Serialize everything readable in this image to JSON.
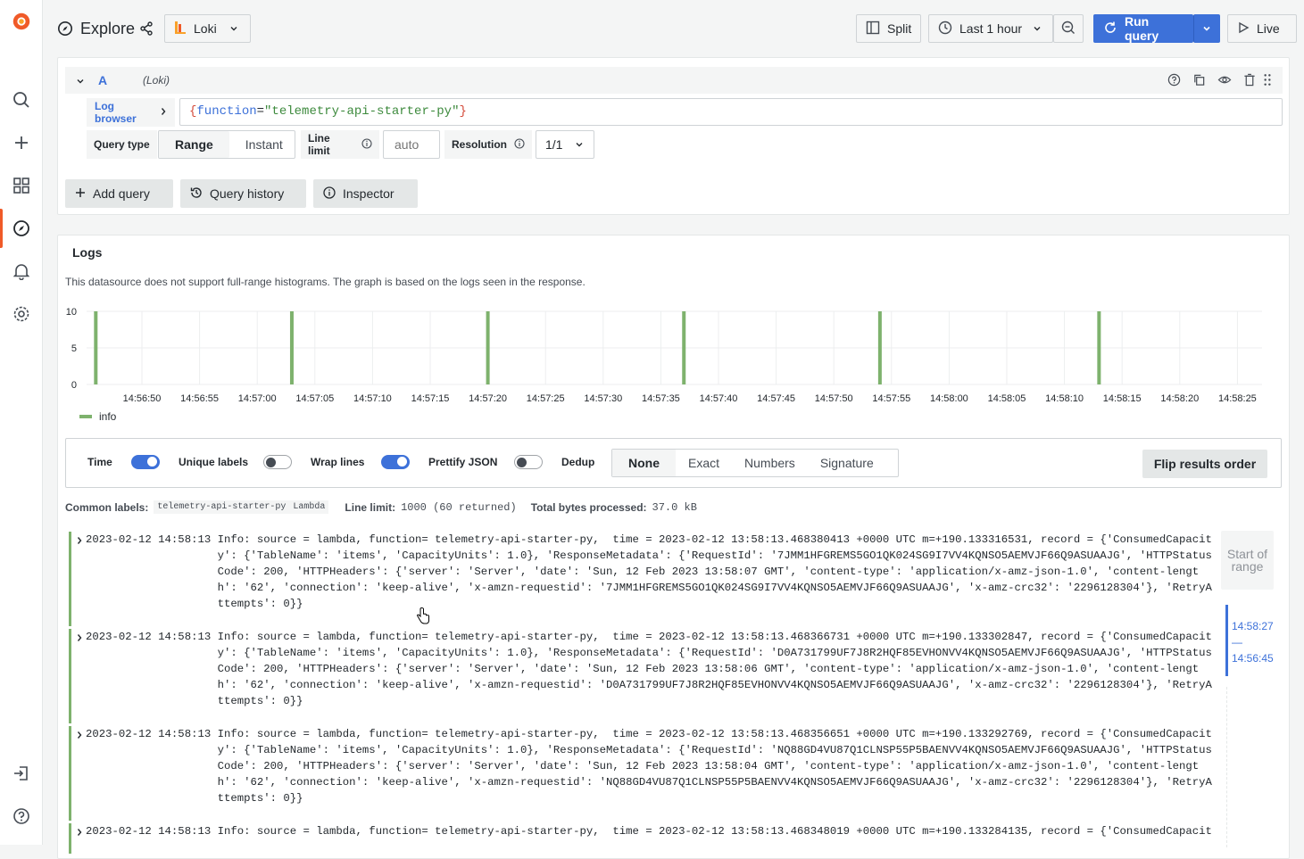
{
  "topbar": {
    "title": "Explore",
    "datasource": "Loki",
    "split": "Split",
    "time_range": "Last 1 hour",
    "run_query": "Run query",
    "live": "Live"
  },
  "query": {
    "ref_id": "A",
    "datasource_hint": "(Loki)",
    "log_browser": "Log browser",
    "expression_key": "function",
    "expression_value": "\"telemetry-api-starter-py\"",
    "query_type_label": "Query type",
    "query_type_options": [
      "Range",
      "Instant"
    ],
    "query_type_selected": "Range",
    "line_limit_label": "Line limit",
    "line_limit_placeholder": "auto",
    "resolution_label": "Resolution",
    "resolution_value": "1/1"
  },
  "actions": {
    "add_query": "Add query",
    "query_history": "Query history",
    "inspector": "Inspector"
  },
  "logs": {
    "title": "Logs",
    "notice": "This datasource does not support full-range histograms. The graph is based on the logs seen in the response.",
    "options": {
      "time": "Time",
      "unique_labels": "Unique labels",
      "wrap_lines": "Wrap lines",
      "prettify_json": "Prettify JSON",
      "dedup": "Dedup",
      "dedup_options": [
        "None",
        "Exact",
        "Numbers",
        "Signature"
      ],
      "dedup_selected": "None",
      "flip": "Flip results order"
    },
    "common_labels_label": "Common labels:",
    "common_labels": [
      "telemetry-api-starter-py",
      "Lambda"
    ],
    "line_limit_label": "Line limit:",
    "line_limit_value": "1000 (60 returned)",
    "bytes_label": "Total bytes processed:",
    "bytes_value": "37.0 kB",
    "range_start": "Start of range",
    "range_to": "14:58:27",
    "range_dash": "—",
    "range_from": "14:56:45",
    "entries": [
      {
        "lines": [
          "2023-02-12 14:58:13 Info: source = lambda, function= telemetry-api-starter-py,  time = 2023-02-12 13:58:13.468380413 +0000 UTC m=+190.133316531, record = {'ConsumedCapacit",
          "                    y': {'TableName': 'items', 'CapacityUnits': 1.0}, 'ResponseMetadata': {'RequestId': '7JMM1HFGREMS5GO1QK024SG9I7VV4KQNSO5AEMVJF66Q9ASUAAJG', 'HTTPStatus",
          "                    Code': 200, 'HTTPHeaders': {'server': 'Server', 'date': 'Sun, 12 Feb 2023 13:58:07 GMT', 'content-type': 'application/x-amz-json-1.0', 'content-lengt",
          "                    h': '62', 'connection': 'keep-alive', 'x-amzn-requestid': '7JMM1HFGREMS5GO1QK024SG9I7VV4KQNSO5AEMVJF66Q9ASUAAJG', 'x-amz-crc32': '2296128304'}, 'RetryA",
          "                    ttempts': 0}}"
        ]
      },
      {
        "lines": [
          "2023-02-12 14:58:13 Info: source = lambda, function= telemetry-api-starter-py,  time = 2023-02-12 13:58:13.468366731 +0000 UTC m=+190.133302847, record = {'ConsumedCapacit",
          "                    y': {'TableName': 'items', 'CapacityUnits': 1.0}, 'ResponseMetadata': {'RequestId': 'D0A731799UF7J8R2HQF85EVHONVV4KQNSO5AEMVJF66Q9ASUAAJG', 'HTTPStatus",
          "                    Code': 200, 'HTTPHeaders': {'server': 'Server', 'date': 'Sun, 12 Feb 2023 13:58:06 GMT', 'content-type': 'application/x-amz-json-1.0', 'content-lengt",
          "                    h': '62', 'connection': 'keep-alive', 'x-amzn-requestid': 'D0A731799UF7J8R2HQF85EVHONVV4KQNSO5AEMVJF66Q9ASUAAJG', 'x-amz-crc32': '2296128304'}, 'RetryA",
          "                    ttempts': 0}}"
        ]
      },
      {
        "lines": [
          "2023-02-12 14:58:13 Info: source = lambda, function= telemetry-api-starter-py,  time = 2023-02-12 13:58:13.468356651 +0000 UTC m=+190.133292769, record = {'ConsumedCapacit",
          "                    y': {'TableName': 'items', 'CapacityUnits': 1.0}, 'ResponseMetadata': {'RequestId': 'NQ88GD4VU87Q1CLNSP55P5BAENVV4KQNSO5AEMVJF66Q9ASUAAJG', 'HTTPStatus",
          "                    Code': 200, 'HTTPHeaders': {'server': 'Server', 'date': 'Sun, 12 Feb 2023 13:58:04 GMT', 'content-type': 'application/x-amz-json-1.0', 'content-lengt",
          "                    h': '62', 'connection': 'keep-alive', 'x-amzn-requestid': 'NQ88GD4VU87Q1CLNSP55P5BAENVV4KQNSO5AEMVJF66Q9ASUAAJG', 'x-amz-crc32': '2296128304'}, 'RetryA",
          "                    ttempts': 0}}"
        ]
      },
      {
        "lines": [
          "2023-02-12 14:58:13 Info: source = lambda, function= telemetry-api-starter-py,  time = 2023-02-12 13:58:13.468348019 +0000 UTC m=+190.133284135, record = {'ConsumedCapacit"
        ]
      }
    ]
  },
  "chart_data": {
    "type": "bar",
    "series": [
      {
        "name": "info",
        "color": "#7eb26d"
      }
    ],
    "ylim": [
      0,
      10
    ],
    "yticks": [
      "10",
      "5",
      "0"
    ],
    "xticks": [
      "14:56:50",
      "14:56:55",
      "14:57:00",
      "14:57:05",
      "14:57:10",
      "14:57:15",
      "14:57:20",
      "14:57:25",
      "14:57:30",
      "14:57:35",
      "14:57:40",
      "14:57:45",
      "14:57:50",
      "14:57:55",
      "14:58:00",
      "14:58:05",
      "14:58:10",
      "14:58:15",
      "14:58:20",
      "14:58:25"
    ],
    "bars": [
      {
        "x": "14:56:46",
        "value": 10
      },
      {
        "x": "14:57:03",
        "value": 10
      },
      {
        "x": "14:57:20",
        "value": 10
      },
      {
        "x": "14:57:37",
        "value": 10
      },
      {
        "x": "14:57:54",
        "value": 10
      },
      {
        "x": "14:58:13",
        "value": 10
      }
    ]
  },
  "colors": {
    "accent": "#3d71d9",
    "log_level_info": "#7eb26d",
    "brand": "#f05a28"
  }
}
